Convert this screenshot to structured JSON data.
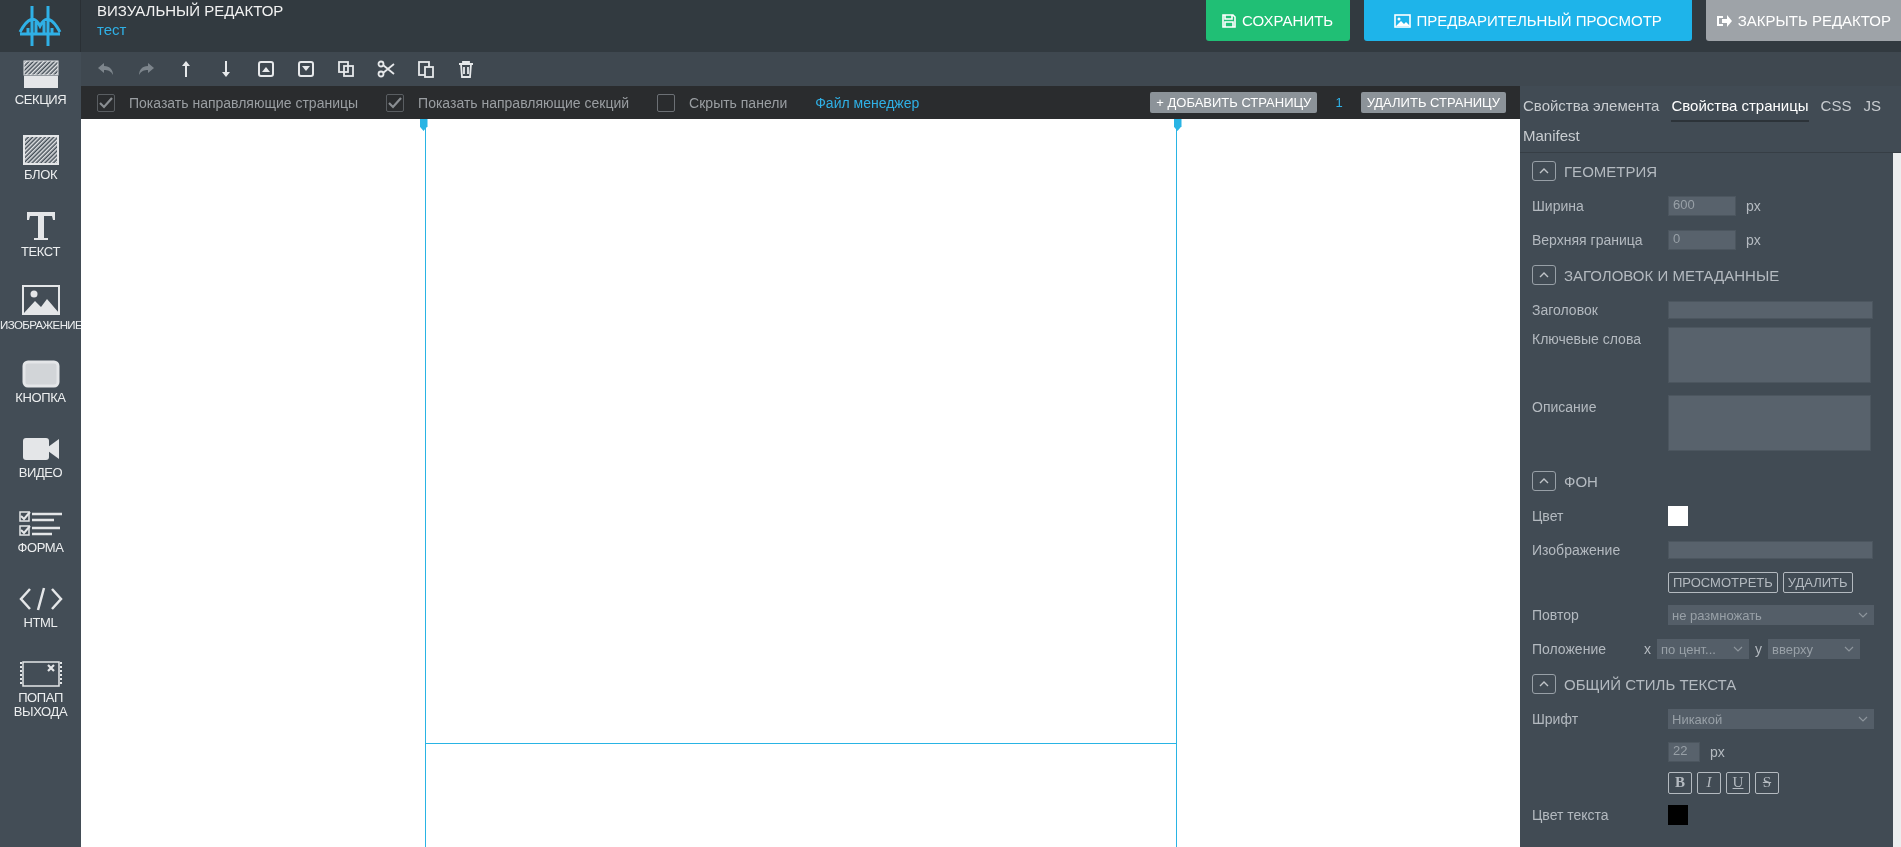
{
  "header": {
    "title": "ВИЗУАЛЬНЫЙ РЕДАКТОР",
    "subtitle": "тест",
    "buttons": [
      {
        "label": "СОХРАНИТЬ",
        "kind": "save"
      },
      {
        "label": "ПРЕДВАРИТЕЛЬНЫЙ ПРОСМОТР",
        "kind": "preview"
      },
      {
        "label": "ЗАКРЫТЬ РЕДАКТОР",
        "kind": "close"
      }
    ]
  },
  "sidebar": {
    "items": [
      {
        "label": "СЕКЦИЯ",
        "kind": "section"
      },
      {
        "label": "БЛОК",
        "kind": "block"
      },
      {
        "label": "ТЕКСТ",
        "kind": "text"
      },
      {
        "label": "ИЗОБРАЖЕНИЕ",
        "kind": "image"
      },
      {
        "label": "КНОПКА",
        "kind": "button"
      },
      {
        "label": "ВИДЕО",
        "kind": "video"
      },
      {
        "label": "ФОРМА",
        "kind": "form"
      },
      {
        "label": "HTML",
        "kind": "html"
      },
      {
        "label": "ПОПАП ВЫХОДА",
        "kind": "popup"
      }
    ]
  },
  "toolbar": [
    {
      "kind": "undo",
      "disabled": true
    },
    {
      "kind": "redo",
      "disabled": true
    },
    {
      "kind": "up",
      "disabled": false
    },
    {
      "kind": "down",
      "disabled": false
    },
    {
      "kind": "top",
      "disabled": false
    },
    {
      "kind": "bottom",
      "disabled": false
    },
    {
      "kind": "copy",
      "disabled": false
    },
    {
      "kind": "cut",
      "disabled": false
    },
    {
      "kind": "paste",
      "disabled": false
    },
    {
      "kind": "delete",
      "disabled": false
    }
  ],
  "options": {
    "checkboxes": [
      {
        "label": "Показать направляющие страницы",
        "checked": true
      },
      {
        "label": "Показать направляющие секций",
        "checked": true
      },
      {
        "label": "Скрыть панели",
        "checked": false
      }
    ],
    "link": "Файл менеджер",
    "add_page": "+ ДОБАВИТЬ СТРАНИЦУ",
    "page_count": "1",
    "delete_page": "УДАЛИТЬ СТРАНИЦУ"
  },
  "panel": {
    "tabs": [
      {
        "label": "Свойства элемента",
        "selected": false
      },
      {
        "label": "Свойства страницы",
        "selected": true
      },
      {
        "label": "CSS",
        "selected": false
      },
      {
        "label": "JS",
        "selected": false
      },
      {
        "label": "Manifest",
        "selected": false
      }
    ],
    "sections": [
      {
        "title": "ГЕОМЕТРИЯ",
        "rows": [
          {
            "kind": "number",
            "label": "Ширина",
            "value": "600",
            "unit": "px"
          },
          {
            "kind": "number",
            "label": "Верхняя граница",
            "value": "0",
            "unit": "px"
          }
        ]
      },
      {
        "title": "ЗАГОЛОВОК И МЕТАДАННЫЕ",
        "rows": [
          {
            "kind": "text",
            "label": "Заголовок"
          },
          {
            "kind": "textarea",
            "label": "Ключевые слова"
          },
          {
            "kind": "textarea",
            "label": "Описание"
          }
        ]
      },
      {
        "title": "ФОН",
        "rows": [
          {
            "kind": "color",
            "label": "Цвет",
            "color": "#ffffff"
          },
          {
            "kind": "text",
            "label": "Изображение"
          },
          {
            "kind": "buttons",
            "buttons": [
              "ПРОСМОТРЕТЬ",
              "УДАЛИТЬ"
            ]
          },
          {
            "kind": "select",
            "label": "Повтор",
            "value": "не размножать"
          },
          {
            "kind": "position",
            "label": "Положение",
            "x_label": "x",
            "x_value": "по цент...",
            "y_label": "y",
            "y_value": "вверху"
          }
        ]
      },
      {
        "title": "ОБЩИЙ СТИЛЬ ТЕКСТА",
        "rows": [
          {
            "kind": "select",
            "label": "Шрифт",
            "value": "Никакой"
          },
          {
            "kind": "size",
            "value": "22",
            "unit": "px"
          },
          {
            "kind": "styles",
            "styles": [
              {
                "text": "B",
                "kind": "bold"
              },
              {
                "text": "I",
                "kind": "italic"
              },
              {
                "text": "U",
                "kind": "underline"
              },
              {
                "text": "S",
                "kind": "strike"
              }
            ]
          },
          {
            "kind": "color",
            "label": "Цвет текста",
            "color": "#000000"
          }
        ]
      }
    ]
  }
}
